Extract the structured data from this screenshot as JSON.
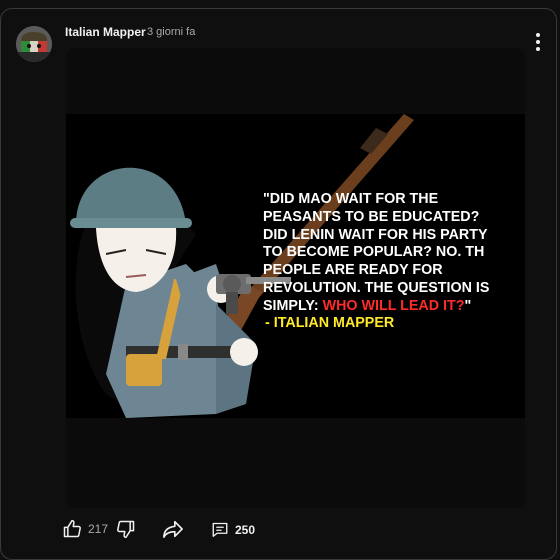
{
  "post": {
    "author": "Italian Mapper",
    "time": "3 giorni fa"
  },
  "image": {
    "quote_lines": [
      "\"DID MAO WAIT FOR THE",
      "PEASANTS TO BE EDUCATED?",
      "DID LENIN WAIT FOR HIS PARTY",
      "TO BECOME POPULAR? NO. TH",
      "PEOPLE ARE READY FOR",
      "REVOLUTION. THE QUESTION IS"
    ],
    "quote_last_prefix": "SIMPLY: ",
    "quote_highlight": "WHO WILL LEAD IT?",
    "quote_close": "\"",
    "signature": " - ITALIAN MAPPER"
  },
  "actions": {
    "likes": "217",
    "comments": "250"
  },
  "icons": {
    "avatar": "avatar-flag",
    "menu": "more-vert-icon",
    "like": "thumbs-up-icon",
    "dislike": "thumbs-down-icon",
    "share": "share-icon",
    "comment": "comment-icon"
  },
  "colors": {
    "background": "#0f0f0f",
    "highlight_red": "#ff2a2a",
    "signature_yellow": "#ffe829"
  }
}
